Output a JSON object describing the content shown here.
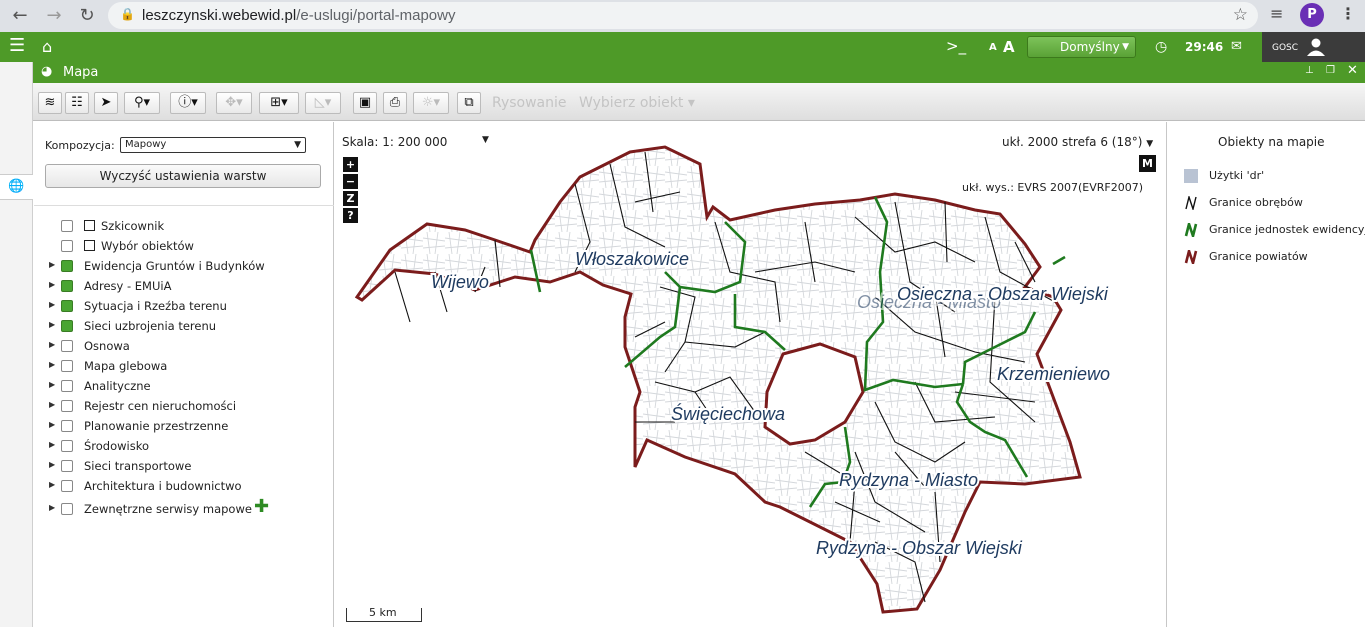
{
  "browser": {
    "url_domain": "leszczynski.webewid.pl",
    "url_path": "/e-uslugi/portal-mapowy",
    "profile_initial": "P"
  },
  "header": {
    "composition": "Domyślny",
    "timer": "29:46",
    "user": "GOSC",
    "font_small": "A",
    "font_large": "A"
  },
  "window": {
    "title": "Mapa"
  },
  "toolbar": {
    "drawing": "Rysowanie",
    "select_object": "Wybierz obiekt"
  },
  "panel": {
    "composition_label": "Kompozycja:",
    "composition_value": "Mapowy",
    "clear_button": "Wyczyść ustawienia warstw",
    "layers": [
      {
        "label": "Szkicownik",
        "checked": false,
        "expandable": false
      },
      {
        "label": "Wybór obiektów",
        "checked": false,
        "expandable": false
      },
      {
        "label": "Ewidencja Gruntów i Budynków",
        "checked": true,
        "expandable": true
      },
      {
        "label": "Adresy - EMUiA",
        "checked": true,
        "expandable": true
      },
      {
        "label": "Sytuacja i Rzeźba terenu",
        "checked": true,
        "expandable": true
      },
      {
        "label": "Sieci uzbrojenia terenu",
        "checked": true,
        "expandable": true
      },
      {
        "label": "Osnowa",
        "checked": false,
        "expandable": true
      },
      {
        "label": "Mapa glebowa",
        "checked": false,
        "expandable": true
      },
      {
        "label": "Analityczne",
        "checked": false,
        "expandable": true
      },
      {
        "label": "Rejestr cen nieruchomości",
        "checked": false,
        "expandable": true
      },
      {
        "label": "Planowanie przestrzenne",
        "checked": false,
        "expandable": true
      },
      {
        "label": "Środowisko",
        "checked": false,
        "expandable": true
      },
      {
        "label": "Sieci transportowe",
        "checked": false,
        "expandable": true
      },
      {
        "label": "Architektura i budownictwo",
        "checked": false,
        "expandable": true
      },
      {
        "label": "Zewnętrzne serwisy mapowe",
        "checked": false,
        "expandable": true
      }
    ]
  },
  "map": {
    "scale_label": "Skala:",
    "scale_value": "1: 200 000",
    "crs": "ukł. 2000 strefa 6 (18°)",
    "height_system": "ukł. wys.: EVRS 2007(EVRF2007)",
    "zoom_in": "+",
    "zoom_out": "−",
    "zoom_z": "Z",
    "help": "?",
    "mode": "M",
    "scalebar": "5 km",
    "places": {
      "wijewo": "Wijewo",
      "wloszakowice": "Włoszakowice",
      "osieczna_obszar": "Osieczna - Obszar Wiejski",
      "osieczna_miasto": "Osieczna - Miasto",
      "krzemieniewo": "Krzemieniewo",
      "swieciechowa": "Święciechowa",
      "rydzyna_miasto": "Rydzyna - Miasto",
      "rydzyna_obszar": "Rydzyna - Obszar Wiejski"
    }
  },
  "legend": {
    "title": "Obiekty na mapie",
    "items": [
      {
        "label": "Użytki 'dr'",
        "color": "#b9c3d3"
      },
      {
        "label": "Granice obrębów",
        "color": "#111111"
      },
      {
        "label": "Granice jednostek ewidencyjnych",
        "color": "#1f7a1f"
      },
      {
        "label": "Granice powiatów",
        "color": "#7b1c1c"
      }
    ]
  },
  "colors": {
    "header_green": "#4e9a28",
    "county_border": "#7b1c1c",
    "unit_border": "#1f7a1f",
    "precinct_border": "#111111"
  }
}
